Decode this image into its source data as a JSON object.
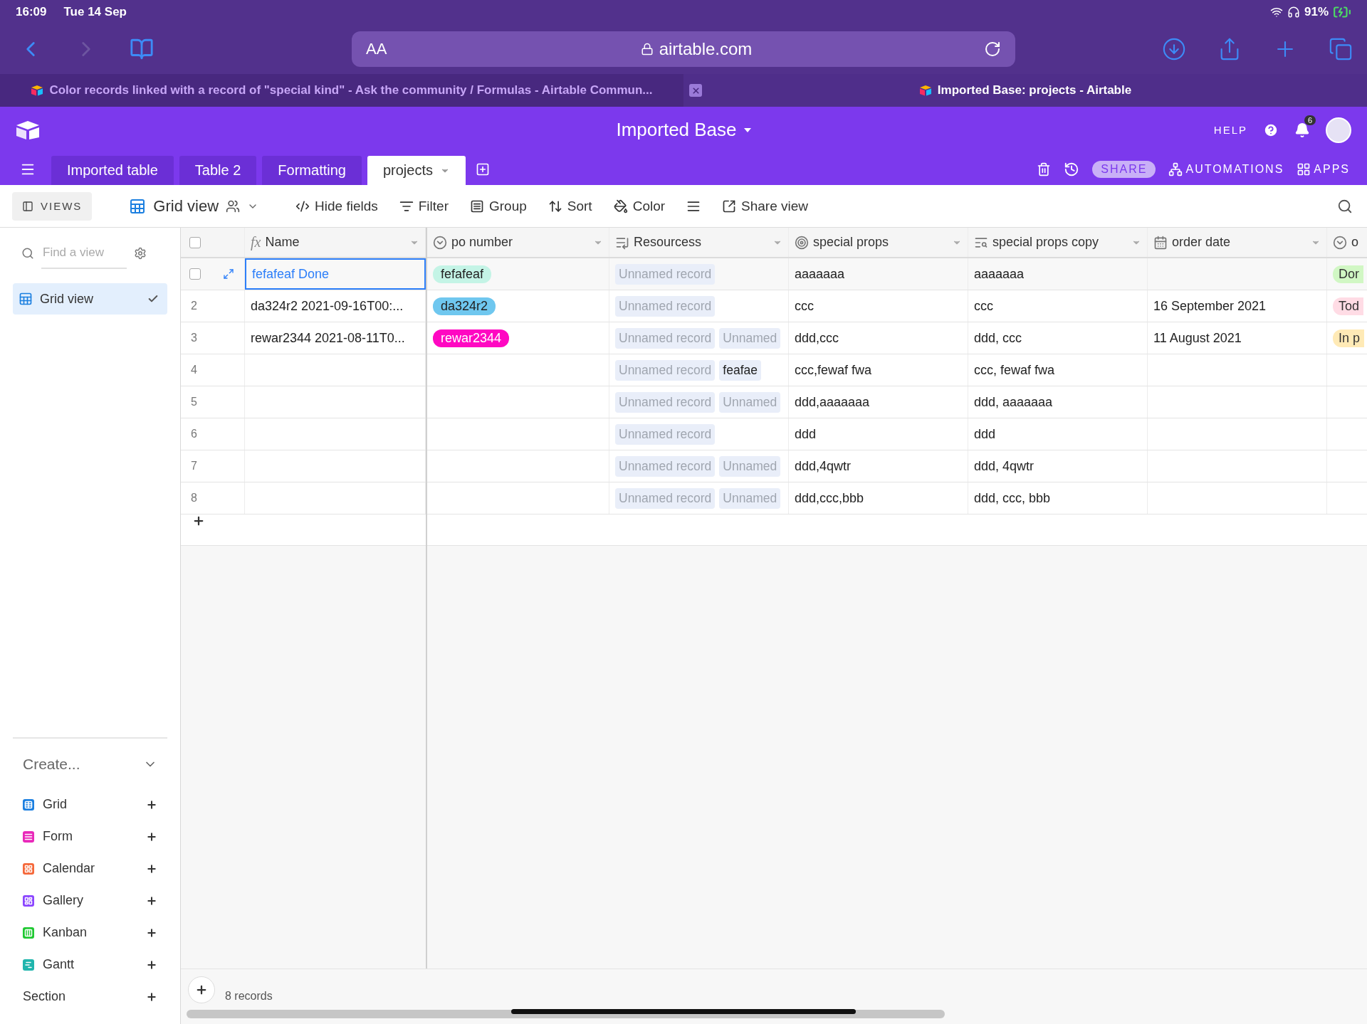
{
  "status_bar": {
    "time": "16:09",
    "date": "Tue 14 Sep",
    "battery": "91%"
  },
  "browser": {
    "text_size": "AA",
    "url": "airtable.com",
    "tabs": [
      {
        "title": "Color records linked with a record of \"special kind\" - Ask the community / Formulas - Airtable Commun...",
        "selected": false
      },
      {
        "title": "Imported Base: projects - Airtable",
        "selected": true
      }
    ]
  },
  "app": {
    "base_title": "Imported Base",
    "help": "HELP",
    "notifications": "6",
    "tables": [
      {
        "label": "Imported table",
        "selected": false
      },
      {
        "label": "Table 2",
        "selected": false
      },
      {
        "label": "Formatting",
        "selected": false
      },
      {
        "label": "projects",
        "selected": true
      }
    ],
    "actions": [
      {
        "label": "SHARE",
        "kind": "share"
      },
      {
        "label": "AUTOMATIONS",
        "kind": "automations"
      },
      {
        "label": "APPS",
        "kind": "apps"
      }
    ]
  },
  "view_bar": {
    "views_label": "VIEWS",
    "view_name": "Grid view",
    "actions": [
      {
        "label": "Hide fields",
        "kind": "hide"
      },
      {
        "label": "Filter",
        "kind": "filter"
      },
      {
        "label": "Group",
        "kind": "group"
      },
      {
        "label": "Sort",
        "kind": "sort"
      },
      {
        "label": "Color",
        "kind": "color"
      },
      {
        "kind": "row_height"
      },
      {
        "label": "Share view",
        "kind": "share"
      }
    ]
  },
  "sidebar": {
    "search_placeholder": "Find a view",
    "views": [
      {
        "label": "Grid view",
        "selected": true
      }
    ],
    "create_label": "Create...",
    "create_items": [
      {
        "label": "Grid",
        "kind": "grid",
        "color": "#1b7fe0"
      },
      {
        "label": "Form",
        "kind": "form",
        "color": "#e929ba"
      },
      {
        "label": "Calendar",
        "kind": "calendar",
        "color": "#f5683a"
      },
      {
        "label": "Gallery",
        "kind": "gallery",
        "color": "#8b46ff"
      },
      {
        "label": "Kanban",
        "kind": "kanban",
        "color": "#20c933"
      },
      {
        "label": "Gantt",
        "kind": "gantt",
        "color": "#20b5ad"
      },
      {
        "label": "Section",
        "kind": "section"
      }
    ]
  },
  "table": {
    "all_checked": false,
    "columns": [
      {
        "name": "Name",
        "kind": "formula",
        "glyph": "fx"
      },
      {
        "name": "po number",
        "kind": "select"
      },
      {
        "name": "Resourcess",
        "kind": "link"
      },
      {
        "name": "special props",
        "kind": "rollup"
      },
      {
        "name": "special props copy",
        "kind": "lookup"
      },
      {
        "name": "order date",
        "kind": "date"
      },
      {
        "name": "o",
        "kind": "select"
      }
    ],
    "rows": [
      {
        "selected": true,
        "checked": false,
        "name": "fefafeaf Done",
        "po": {
          "text": "fefafeaf",
          "color": "#c4f4e6"
        },
        "resources": [
          {
            "text": "Unnamed record",
            "unnamed": true
          }
        ],
        "special": "aaaaaaa",
        "special_copy": "aaaaaaa",
        "status": {
          "text": "Dor",
          "color": "#d1f7c4"
        }
      },
      {
        "selected": false,
        "checked": false,
        "number": "2",
        "name": "da324r2 2021-09-16T00:...",
        "po": {
          "text": "da324r2",
          "color": "#6fc7ef"
        },
        "resources": [
          {
            "text": "Unnamed record",
            "unnamed": true
          }
        ],
        "special": "ccc",
        "special_copy": "ccc",
        "order_date": "16 September 2021",
        "status": {
          "text": "Tod",
          "color": "#ffdce5"
        }
      },
      {
        "selected": false,
        "checked": false,
        "number": "3",
        "name": "rewar2344 2021-08-11T0...",
        "po": {
          "text": "rewar2344",
          "color": "#ff08c2"
        },
        "resources": [
          {
            "text": "Unnamed record",
            "unnamed": true
          },
          {
            "text": "Unnamed",
            "unnamed": true
          }
        ],
        "special": "ddd,ccc",
        "special_copy": "ddd, ccc",
        "order_date": "11 August 2021",
        "status": {
          "text": "In p",
          "color": "#ffeab6"
        }
      },
      {
        "selected": false,
        "checked": false,
        "number": "4",
        "resources": [
          {
            "text": "Unnamed record",
            "unnamed": true
          },
          {
            "text": "feafae",
            "unnamed": false
          }
        ],
        "special": "ccc,fewaf fwa",
        "special_copy": "ccc, fewaf fwa"
      },
      {
        "selected": false,
        "checked": false,
        "number": "5",
        "resources": [
          {
            "text": "Unnamed record",
            "unnamed": true
          },
          {
            "text": "Unnamed",
            "unnamed": true
          }
        ],
        "special": "ddd,aaaaaaa",
        "special_copy": "ddd, aaaaaaa"
      },
      {
        "selected": false,
        "checked": false,
        "number": "6",
        "resources": [
          {
            "text": "Unnamed record",
            "unnamed": true
          }
        ],
        "special": "ddd",
        "special_copy": "ddd"
      },
      {
        "selected": false,
        "checked": false,
        "number": "7",
        "resources": [
          {
            "text": "Unnamed record",
            "unnamed": true
          },
          {
            "text": "Unnamed",
            "unnamed": true
          }
        ],
        "special": "ddd,4qwtr",
        "special_copy": "ddd, 4qwtr"
      },
      {
        "selected": false,
        "checked": false,
        "number": "8",
        "resources": [
          {
            "text": "Unnamed record",
            "unnamed": true
          },
          {
            "text": "Unnamed",
            "unnamed": true
          }
        ],
        "special": "ddd,ccc,bbb",
        "special_copy": "ddd, ccc, bbb"
      }
    ]
  },
  "footer": {
    "record_count": "8 records"
  }
}
